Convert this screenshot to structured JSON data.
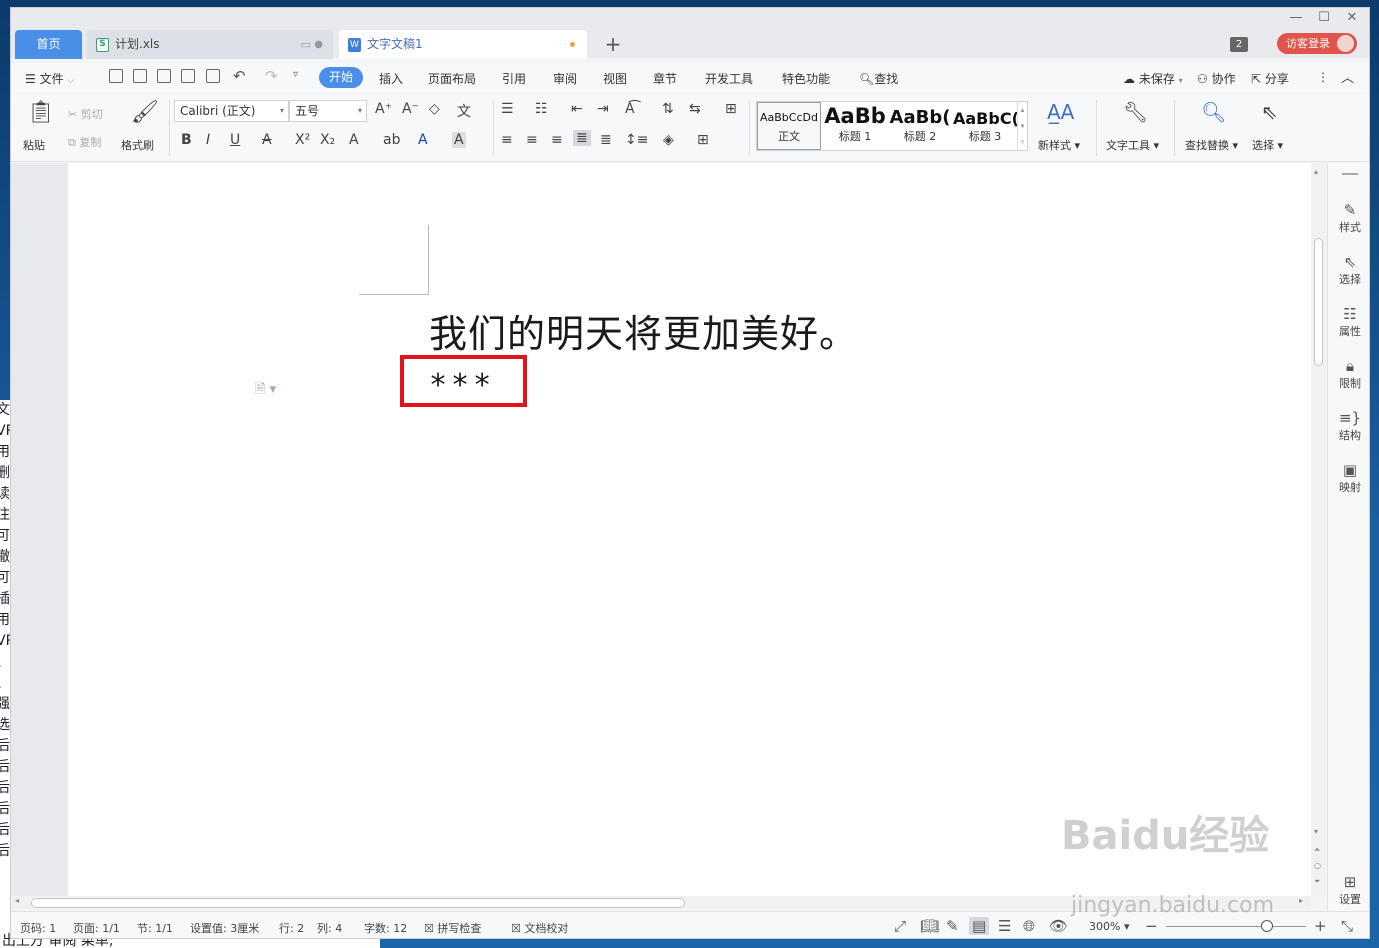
{
  "tabs": {
    "home": "首页",
    "xls": "计划.xls",
    "doc": "文字文稿1",
    "badge_count": "2",
    "login": "访客登录"
  },
  "menu": {
    "file": "文件",
    "start": "开始",
    "insert": "插入",
    "layout": "页面布局",
    "reference": "引用",
    "review": "审阅",
    "view": "视图",
    "chapter": "章节",
    "devtools": "开发工具",
    "features": "特色功能",
    "search": "查找",
    "unsaved": "未保存",
    "collab": "协作",
    "share": "分享"
  },
  "ribbon": {
    "paste": "粘贴",
    "cut": "剪切",
    "copy": "复制",
    "format_painter": "格式刷",
    "font_name": "Calibri (正文)",
    "font_size": "五号",
    "styles": [
      {
        "preview": "AaBbCcDd",
        "caption": "正文"
      },
      {
        "preview": "AaBb",
        "caption": "标题 1"
      },
      {
        "preview": "AaBb(",
        "caption": "标题 2"
      },
      {
        "preview": "AaBbC(",
        "caption": "标题 3"
      }
    ],
    "new_style": "新样式",
    "text_tools": "文字工具",
    "find_replace": "查找替换",
    "select": "选择"
  },
  "document": {
    "line1": "我们的明天将更加美好。",
    "line2": "***"
  },
  "sidebar": {
    "style": "样式",
    "select": "选择",
    "property": "属性",
    "restrict": "限制",
    "structure": "结构",
    "map": "映射",
    "settings": "设置"
  },
  "status": {
    "page_num": "页码: 1",
    "pages": "页面: 1/1",
    "section": "节: 1/1",
    "setting": "设置值: 3厘米",
    "row": "行: 2",
    "col": "列: 4",
    "wordcount": "字数: 12",
    "spellcheck": "拼写检查",
    "doccheck": "文档校对",
    "zoom": "300%"
  },
  "background": {
    "left_lines": [
      "文件",
      "VP",
      "用",
      "删",
      "读",
      "注三",
      "可以",
      "撤",
      "可以",
      "插",
      "用",
      "VP",
      "、",
      "、",
      "强",
      "选",
      "后",
      "后",
      "后",
      "后",
      "后",
      "后"
    ],
    "bottom_line": "出上方   审阅   菜单;"
  },
  "watermark": {
    "logo": "Baidu经验",
    "url": "jingyan.baidu.com"
  }
}
